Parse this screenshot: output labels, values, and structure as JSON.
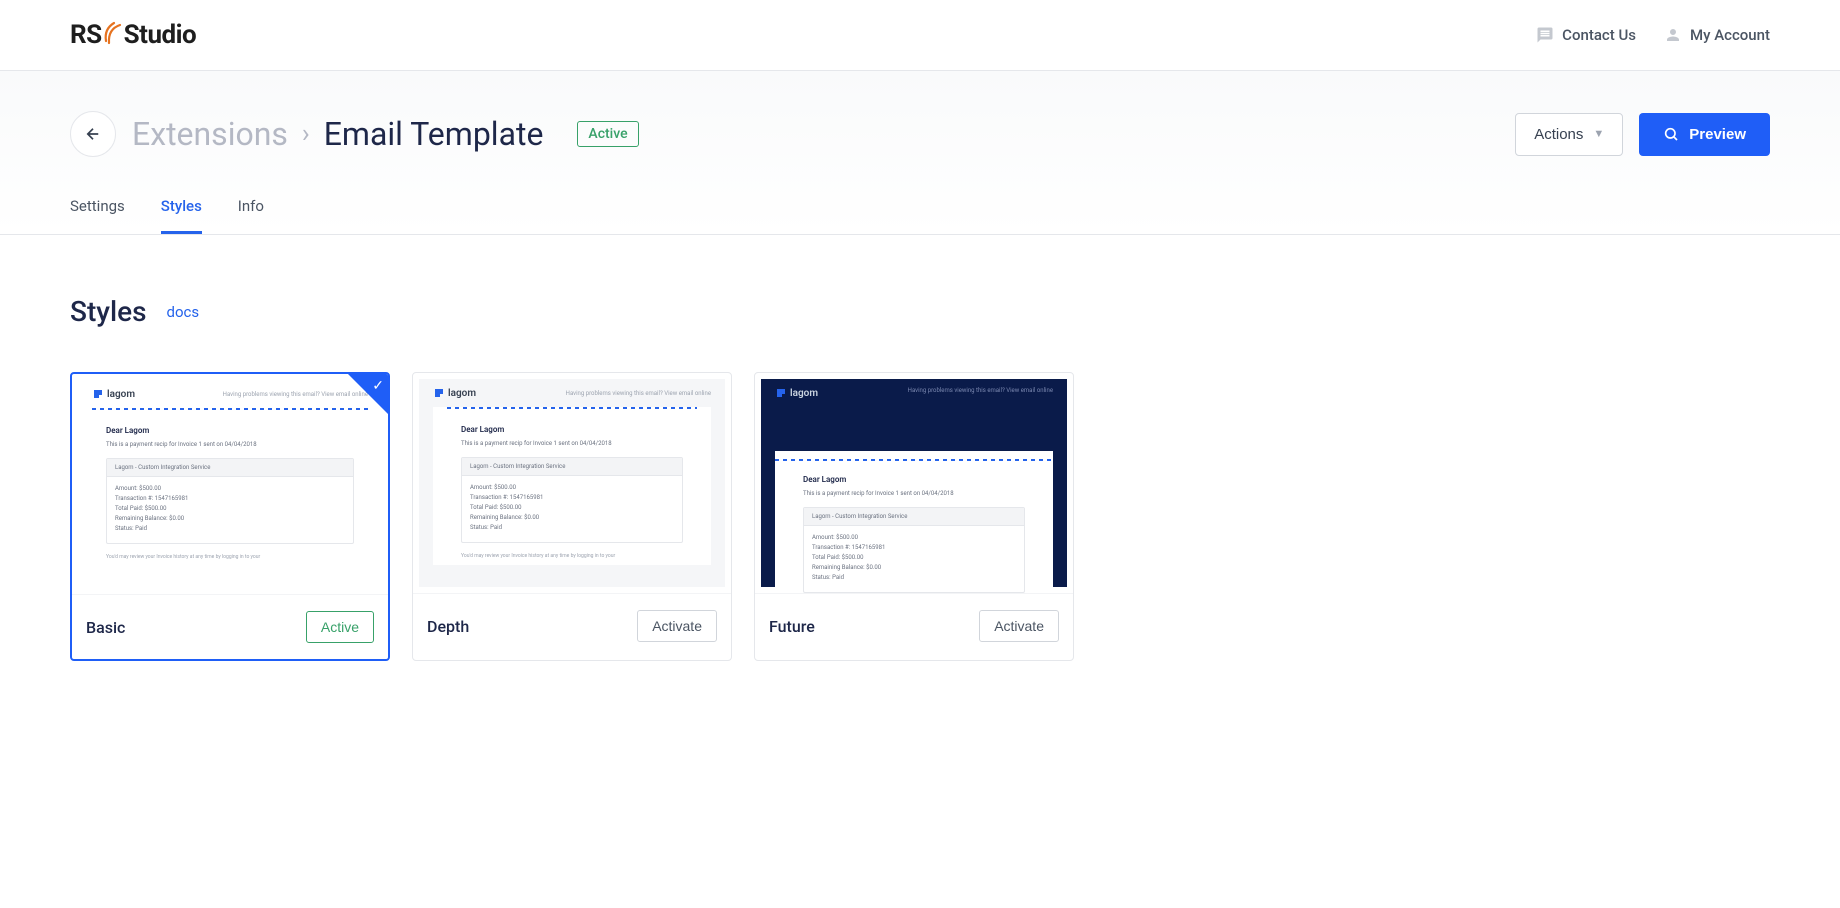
{
  "brand": {
    "prefix": "RS",
    "suffix": "Studio"
  },
  "topnav": {
    "contact": "Contact Us",
    "account": "My Account"
  },
  "header": {
    "breadcrumb_prev": "Extensions",
    "breadcrumb_current": "Email Template",
    "status": "Active",
    "actions_label": "Actions",
    "preview_label": "Preview"
  },
  "tabs": {
    "settings": "Settings",
    "styles": "Styles",
    "info": "Info"
  },
  "section": {
    "title": "Styles",
    "docs": "docs"
  },
  "styles": {
    "basic": {
      "name": "Basic",
      "action": "Active"
    },
    "depth": {
      "name": "Depth",
      "action": "Activate"
    },
    "future": {
      "name": "Future",
      "action": "Activate"
    }
  },
  "email_mock": {
    "logo": "lagom",
    "view_online": "Having problems viewing this email? View email online",
    "greeting": "Dear Lagom",
    "subtitle": "This is a payment recip for Invoice 1 sent on 04/04/2018",
    "box_head": "Lagom - Custom Integration Service",
    "amount": "Amount: $500.00",
    "transaction": "Transaction #: 1547165981",
    "total_paid": "Total Paid: $500.00",
    "remaining": "Remaining Balance: $0.00",
    "status": "Status: Paid",
    "footnote": "You'd may review your Invoice history at any time by logging in to your"
  }
}
